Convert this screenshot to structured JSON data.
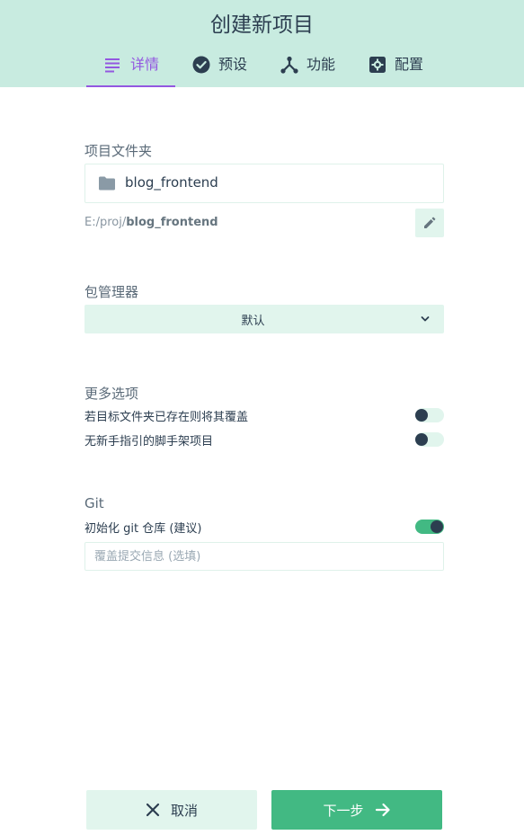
{
  "header": {
    "title": "创建新项目",
    "tabs": [
      {
        "label": "详情",
        "icon": "list-icon",
        "active": true
      },
      {
        "label": "预设",
        "icon": "check-circle-icon",
        "active": false
      },
      {
        "label": "功能",
        "icon": "features-icon",
        "active": false
      },
      {
        "label": "配置",
        "icon": "gear-icon",
        "active": false
      }
    ]
  },
  "folder": {
    "label": "项目文件夹",
    "value": "blog_frontend",
    "path_prefix": "E:/proj/",
    "path_name": "blog_frontend"
  },
  "package_manager": {
    "label": "包管理器",
    "selected": "默认"
  },
  "more_options": {
    "label": "更多选项",
    "options": [
      {
        "label": "若目标文件夹已存在则将其覆盖",
        "enabled": false
      },
      {
        "label": "无新手指引的脚手架项目",
        "enabled": false
      }
    ]
  },
  "git": {
    "label": "Git",
    "init_label": "初始化 git 仓库 (建议)",
    "init_enabled": true,
    "commit_placeholder": "覆盖提交信息 (选填)"
  },
  "footer": {
    "cancel_label": "取消",
    "next_label": "下一步"
  },
  "colors": {
    "header_bg": "#c8ebe0",
    "accent": "#9358e0",
    "primary": "#42b983",
    "light": "#e1f5ed",
    "text": "#2c3e50"
  }
}
